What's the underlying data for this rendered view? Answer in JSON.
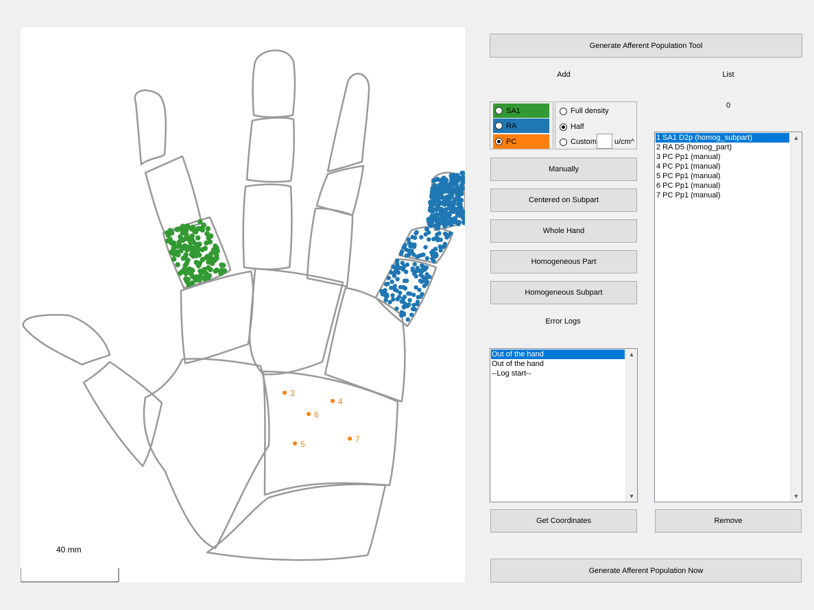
{
  "canvas": {
    "scale_label": "40 mm",
    "manual_points": [
      "3",
      "4",
      "6",
      "5",
      "7"
    ]
  },
  "buttons": {
    "generate_tool": "Generate Afferent Population Tool",
    "manually": "Manually",
    "centered": "Centered on Subpart",
    "whole_hand": "Whole Hand",
    "homog_part": "Homogeneous Part",
    "homog_subpart": "Homogeneous Subpart",
    "get_coordinates": "Get Coordinates",
    "remove": "Remove",
    "generate_now": "Generate Afferent Population Now"
  },
  "labels": {
    "add": "Add",
    "list": "List",
    "list_count": "0",
    "error_logs": "Error Logs"
  },
  "afferent_types": [
    {
      "label": "SA1",
      "color": "#339933",
      "selected": false
    },
    {
      "label": "RA",
      "color": "#1f77b4",
      "selected": false
    },
    {
      "label": "PC",
      "color": "#ff7f0e",
      "selected": true
    }
  ],
  "density_options": {
    "full": "Full density",
    "half": "Half",
    "custom": "Custom:",
    "custom_value": "",
    "unit": "u/cm^",
    "selected": "half"
  },
  "population_list": [
    "1 SA1 D2p (homog_subpart)",
    "2 RA D5 (homog_part)",
    "3 PC Pp1 (manual)",
    "4 PC Pp1 (manual)",
    "5 PC Pp1 (manual)",
    "6 PC Pp1 (manual)",
    "7 PC Pp1 (manual)"
  ],
  "error_log": [
    "Out of the hand",
    "Out of the hand",
    "--Log start--"
  ],
  "colors": {
    "sa1": "#339933",
    "ra": "#1f77b4",
    "pc": "#ff7f0e",
    "outline": "#999999",
    "selection": "#0078d7"
  }
}
